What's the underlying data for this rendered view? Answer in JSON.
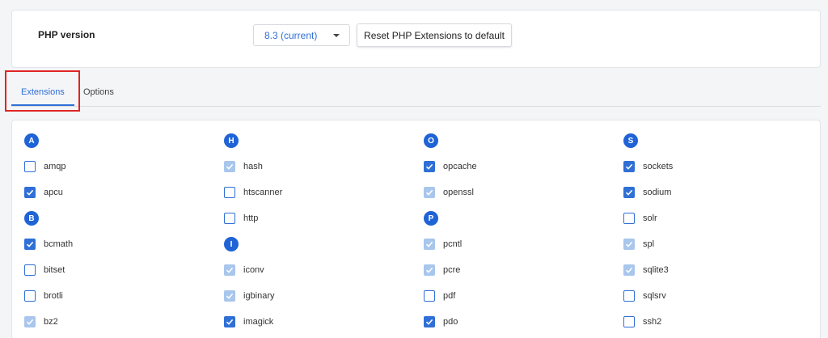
{
  "php": {
    "label": "PHP version",
    "selected_version": "8.3 (current)",
    "reset_label": "Reset PHP Extensions to default"
  },
  "tabs": [
    {
      "label": "Extensions",
      "active": true
    },
    {
      "label": "Options",
      "active": false
    }
  ],
  "colors": {
    "accent": "#2f6fd6",
    "letter_badge": "#1f63d6",
    "disabled_check": "#a9c6ec",
    "highlight": "#e02424"
  },
  "columns": [
    {
      "items": [
        {
          "kind": "letter",
          "text": "A"
        },
        {
          "kind": "ext",
          "name": "amqp",
          "state": "unchecked"
        },
        {
          "kind": "ext",
          "name": "apcu",
          "state": "checked"
        },
        {
          "kind": "letter",
          "text": "B"
        },
        {
          "kind": "ext",
          "name": "bcmath",
          "state": "checked"
        },
        {
          "kind": "ext",
          "name": "bitset",
          "state": "unchecked"
        },
        {
          "kind": "ext",
          "name": "brotli",
          "state": "unchecked"
        },
        {
          "kind": "ext",
          "name": "bz2",
          "state": "disabled"
        }
      ]
    },
    {
      "items": [
        {
          "kind": "letter",
          "text": "H"
        },
        {
          "kind": "ext",
          "name": "hash",
          "state": "disabled"
        },
        {
          "kind": "ext",
          "name": "htscanner",
          "state": "unchecked"
        },
        {
          "kind": "ext",
          "name": "http",
          "state": "unchecked"
        },
        {
          "kind": "letter",
          "text": "I"
        },
        {
          "kind": "ext",
          "name": "iconv",
          "state": "disabled"
        },
        {
          "kind": "ext",
          "name": "igbinary",
          "state": "disabled"
        },
        {
          "kind": "ext",
          "name": "imagick",
          "state": "checked"
        }
      ]
    },
    {
      "items": [
        {
          "kind": "letter",
          "text": "O"
        },
        {
          "kind": "ext",
          "name": "opcache",
          "state": "checked"
        },
        {
          "kind": "ext",
          "name": "openssl",
          "state": "disabled"
        },
        {
          "kind": "letter",
          "text": "P"
        },
        {
          "kind": "ext",
          "name": "pcntl",
          "state": "disabled"
        },
        {
          "kind": "ext",
          "name": "pcre",
          "state": "disabled"
        },
        {
          "kind": "ext",
          "name": "pdf",
          "state": "unchecked"
        },
        {
          "kind": "ext",
          "name": "pdo",
          "state": "checked"
        }
      ]
    },
    {
      "items": [
        {
          "kind": "letter",
          "text": "S"
        },
        {
          "kind": "ext",
          "name": "sockets",
          "state": "checked"
        },
        {
          "kind": "ext",
          "name": "sodium",
          "state": "checked"
        },
        {
          "kind": "ext",
          "name": "solr",
          "state": "unchecked"
        },
        {
          "kind": "ext",
          "name": "spl",
          "state": "disabled"
        },
        {
          "kind": "ext",
          "name": "sqlite3",
          "state": "disabled"
        },
        {
          "kind": "ext",
          "name": "sqlsrv",
          "state": "unchecked"
        },
        {
          "kind": "ext",
          "name": "ssh2",
          "state": "unchecked"
        }
      ]
    }
  ]
}
